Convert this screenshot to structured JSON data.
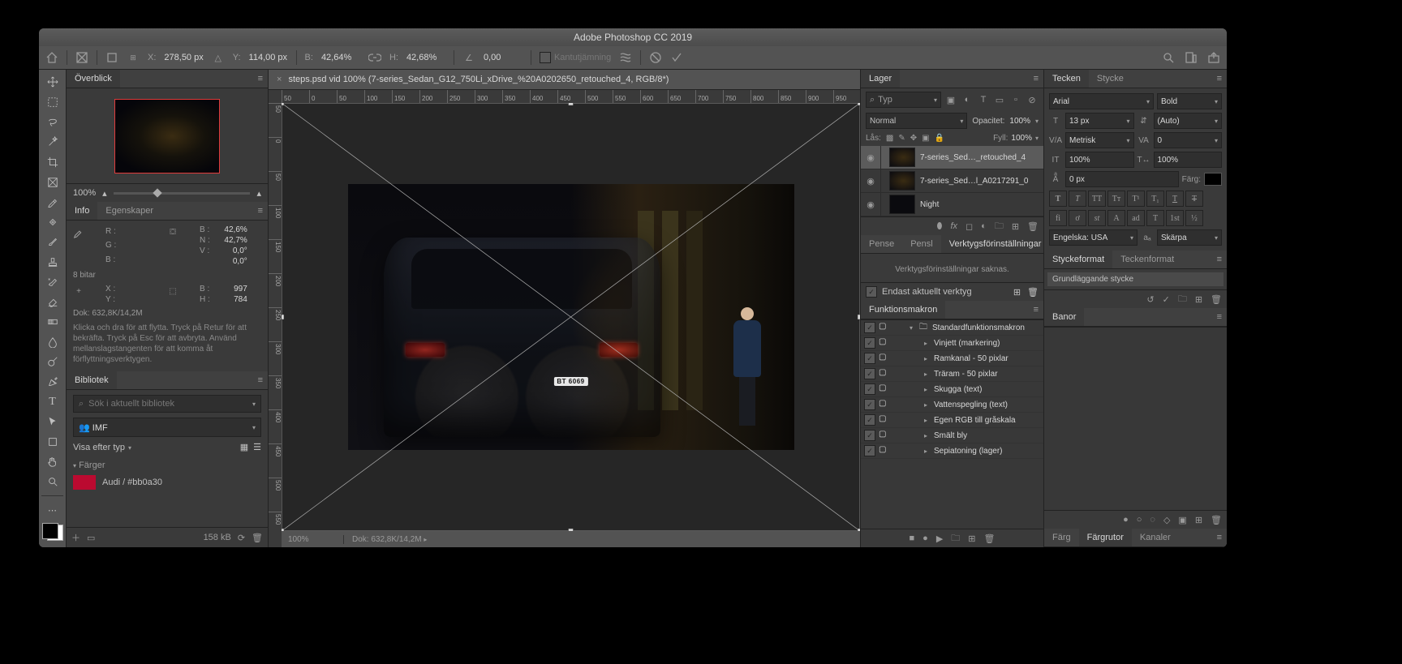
{
  "app_title": "Adobe Photoshop CC 2019",
  "optionbar": {
    "x_label": "X:",
    "x_value": "278,50 px",
    "y_label": "Y:",
    "y_value": "114,00 px",
    "w_label": "B:",
    "w_value": "42,64%",
    "h_label": "H:",
    "h_value": "42,68%",
    "angle_label": "∆",
    "angle_value": "0,00",
    "interp": "Kantutjämning"
  },
  "document": {
    "tab": "steps.psd vid 100% (7-series_Sedan_G12_750Li_xDrive_%20A0202650_retouched_4, RGB/8*)",
    "zoom": "100%",
    "size": "Dok: 632,8K/14,2M",
    "plate": "BT 6069"
  },
  "ruler_h": [
    "50",
    "0",
    "50",
    "100",
    "150",
    "200",
    "250",
    "300",
    "350",
    "400",
    "450",
    "500",
    "550",
    "600",
    "650",
    "700",
    "750",
    "800",
    "850",
    "900",
    "950"
  ],
  "ruler_v": [
    "50",
    "0",
    "50",
    "100",
    "150",
    "200",
    "250",
    "300",
    "350",
    "400",
    "450",
    "500",
    "550"
  ],
  "navigator": {
    "tab": "Överblick",
    "zoom": "100%"
  },
  "info": {
    "tab_info": "Info",
    "tab_props": "Egenskaper",
    "rgb": {
      "R": "R :",
      "G": "G :",
      "B": "B :"
    },
    "wh": {
      "B": "B :",
      "Bv": "42,6%",
      "N": "N :",
      "Nv": "42,7%",
      "V": "V :",
      "Vv": "0,0°",
      "Dv": "0,0°"
    },
    "bitar": "8 bitar",
    "xy": {
      "X": "X :",
      "Y": "Y :"
    },
    "wh2": {
      "B": "B :",
      "Bv": "997",
      "H": "H :",
      "Hv": "784"
    },
    "dok": "Dok: 632,8K/14,2M",
    "hint": "Klicka och dra för att flytta. Tryck på Retur för att bekräfta. Tryck på Esc för att avbryta. Använd mellanslagstangenten för att komma åt förflyttningsverktygen."
  },
  "library": {
    "tab": "Bibliotek",
    "search_ph": "Sök i aktuellt bibliotek",
    "lib_name": "IMF",
    "filter": "Visa efter typ",
    "group": "Färger",
    "swatch_name": "Audi / #bb0a30",
    "footer_size": "158 kB"
  },
  "layers": {
    "tab": "Lager",
    "filter_label": "Typ",
    "blend": "Normal",
    "opacity_lbl": "Opacitet:",
    "opacity": "100%",
    "lock_lbl": "Lås:",
    "fill_lbl": "Fyll:",
    "fill": "100%",
    "items": [
      {
        "name": "7-series_Sed…_retouched_4",
        "sel": true,
        "th": "img"
      },
      {
        "name": "7-series_Sed…l_A0217291_0",
        "sel": false,
        "th": "img"
      },
      {
        "name": "Night",
        "sel": false,
        "th": "blank"
      }
    ]
  },
  "brush": {
    "tabs": [
      "Pense",
      "Pensl",
      "Verktygsförinställningar"
    ],
    "msg": "Verktygsförinställningar saknas.",
    "chk_label": "Endast aktuellt verktyg"
  },
  "actions": {
    "tab": "Funktionsmakron",
    "set": "Standardfunktionsmakron",
    "items": [
      "Vinjett (markering)",
      "Ramkanal - 50 pixlar",
      "Träram - 50 pixlar",
      "Skugga (text)",
      "Vattenspegling (text)",
      "Egen RGB till gråskala",
      "Smält bly",
      "Sepiatoning (lager)"
    ]
  },
  "char": {
    "tab_tecken": "Tecken",
    "tab_stycke": "Stycke",
    "font": "Arial",
    "style": "Bold",
    "size": "13 px",
    "leading": "(Auto)",
    "kerning": "Metrisk",
    "tracking": "0",
    "vscale": "100%",
    "hscale": "100%",
    "baseline": "0 px",
    "color_lbl": "Färg:",
    "lang": "Engelska: USA",
    "aa": "Skärpa"
  },
  "pstyles": {
    "tab_p": "Styckeformat",
    "tab_c": "Teckenformat",
    "item": "Grundläggande stycke"
  },
  "paths": {
    "tab": "Banor"
  },
  "swatches": {
    "tab_color": "Färg",
    "tab_sw": "Färgrutor",
    "tab_ch": "Kanaler"
  }
}
